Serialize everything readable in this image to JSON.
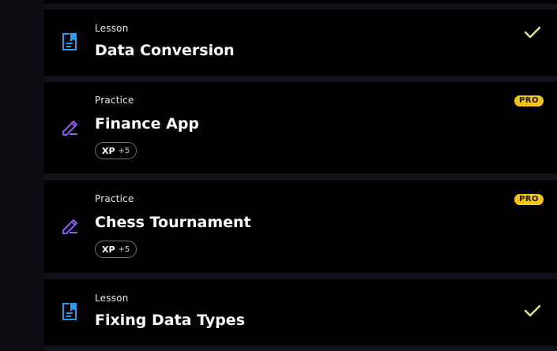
{
  "items": [
    {
      "type_label": "Lesson",
      "title": "Data Conversion",
      "icon": "lesson-document-icon",
      "status_icon": "checkmark-icon"
    },
    {
      "type_label": "Practice",
      "title": "Finance App",
      "icon": "practice-pencil-icon",
      "badge": "PRO",
      "xp_label": "XP",
      "xp_value": "+5"
    },
    {
      "type_label": "Practice",
      "title": "Chess Tournament",
      "icon": "practice-pencil-icon",
      "badge": "PRO",
      "xp_label": "XP",
      "xp_value": "+5"
    },
    {
      "type_label": "Lesson",
      "title": "Fixing Data Types",
      "icon": "lesson-document-icon",
      "status_icon": "checkmark-icon"
    }
  ],
  "colors": {
    "lesson_icon": "#2f9bef",
    "practice_icon": "#8c5cf0",
    "check": "#d6e98a",
    "pro_badge": "#f6c416",
    "card_bg": "#000000",
    "page_bg": "#0b0d12"
  }
}
